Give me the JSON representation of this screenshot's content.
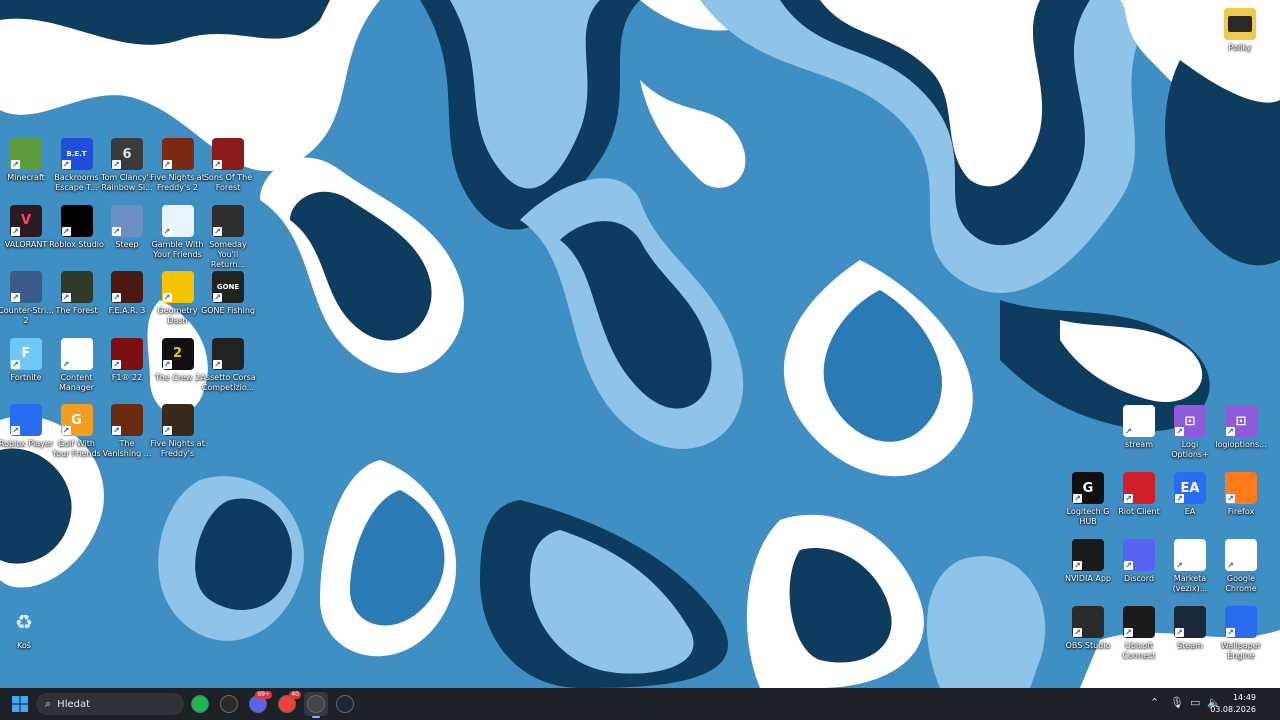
{
  "desktop": {
    "left_icons": [
      {
        "name": "minecraft",
        "label": "Minecraft",
        "glyph": "",
        "bg": "#5c9c3c",
        "fg": "#ffffff"
      },
      {
        "name": "backrooms",
        "label": "Backrooms Escape T...",
        "glyph": "B.E.T",
        "bg": "#1f4fd8",
        "fg": "#ffffff"
      },
      {
        "name": "rainbow-six",
        "label": "Tom Clancy's Rainbow Si...",
        "glyph": "6",
        "bg": "#3b3b3b",
        "fg": "#e0e0e0"
      },
      {
        "name": "fnaf2",
        "label": "Five Nights at Freddy's 2",
        "glyph": "",
        "bg": "#7a2a10",
        "fg": "#ffffff"
      },
      {
        "name": "sons-of-forest",
        "label": "Sons Of The Forest",
        "glyph": "",
        "bg": "#8e1b1b",
        "fg": "#ffffff"
      },
      {
        "name": "valorant",
        "label": "VALORANT",
        "glyph": "V",
        "bg": "#2a1a22",
        "fg": "#ff4655"
      },
      {
        "name": "roblox-studio",
        "label": "Roblox Studio",
        "glyph": "",
        "bg": "#000000",
        "fg": "#ffffff"
      },
      {
        "name": "steep",
        "label": "Steep",
        "glyph": "",
        "bg": "#6a8fc0",
        "fg": "#ffffff"
      },
      {
        "name": "gamble",
        "label": "Gamble With Your Friends",
        "glyph": "",
        "bg": "#e8f4ff",
        "fg": "#1c5fb0"
      },
      {
        "name": "someday",
        "label": "Someday You'll Return...",
        "glyph": "",
        "bg": "#2e2e2e",
        "fg": "#c9a86a"
      },
      {
        "name": "counter-strike",
        "label": "Counter-Stri... 2",
        "glyph": "",
        "bg": "#3c5a8a",
        "fg": "#f5a623"
      },
      {
        "name": "the-forest",
        "label": "The Forest",
        "glyph": "",
        "bg": "#2f3a2a",
        "fg": "#c8c8c8"
      },
      {
        "name": "fear3",
        "label": "F.E.A.R. 3",
        "glyph": "",
        "bg": "#4a1a12",
        "fg": "#e9b44c"
      },
      {
        "name": "geometry-dash",
        "label": "Geometry Dash",
        "glyph": "",
        "bg": "#f5c400",
        "fg": "#2a7a1a"
      },
      {
        "name": "gone-fishing",
        "label": "GONE Fishing",
        "glyph": "GONE",
        "bg": "#222222",
        "fg": "#ffffff"
      },
      {
        "name": "fortnite",
        "label": "Fortnite",
        "glyph": "F",
        "bg": "#6ec8f5",
        "fg": "#ffffff"
      },
      {
        "name": "content-manager",
        "label": "Content Manager",
        "glyph": "",
        "bg": "#ffffff",
        "fg": "#e02020"
      },
      {
        "name": "f1-22",
        "label": "F1® 22",
        "glyph": "",
        "bg": "#7a1010",
        "fg": "#ffffff"
      },
      {
        "name": "the-crew-2",
        "label": "The Crew 2",
        "glyph": "2",
        "bg": "#111111",
        "fg": "#f5c400"
      },
      {
        "name": "assetto-corsa",
        "label": "Assetto Corsa Competizio...",
        "glyph": "",
        "bg": "#222222",
        "fg": "#e02020"
      },
      {
        "name": "roblox-player",
        "label": "Roblox Player",
        "glyph": "",
        "bg": "#2a6cf0",
        "fg": "#ffffff"
      },
      {
        "name": "golf",
        "label": "Golf With Your Friends",
        "glyph": "G",
        "bg": "#f29d1f",
        "fg": "#ffffff"
      },
      {
        "name": "vanishing",
        "label": "The Vanishing ...",
        "glyph": "",
        "bg": "#6a2a10",
        "fg": "#f0c080"
      },
      {
        "name": "fnaf",
        "label": "Five Nights at Freddy's",
        "glyph": "",
        "bg": "#3a2a1a",
        "fg": "#ffffff"
      }
    ],
    "right_icons": [
      {
        "name": "stream",
        "label": "stream",
        "glyph": "",
        "bg": "#ffffff",
        "fg": "#444444"
      },
      {
        "name": "logi-options",
        "label": "Logi Options+",
        "glyph": "⊡",
        "bg": "#8f5bd8",
        "fg": "#ffffff"
      },
      {
        "name": "logioptions",
        "label": "logioptions...",
        "glyph": "⊡",
        "bg": "#8f5bd8",
        "fg": "#ffffff"
      },
      {
        "name": "logitech-g-hub",
        "label": "Logitech G HUB",
        "glyph": "G",
        "bg": "#111111",
        "fg": "#ffffff"
      },
      {
        "name": "riot-client",
        "label": "Riot Client",
        "glyph": "",
        "bg": "#d0202a",
        "fg": "#ffffff"
      },
      {
        "name": "ea",
        "label": "EA",
        "glyph": "EA",
        "bg": "#2a6cf0",
        "fg": "#ffffff"
      },
      {
        "name": "firefox",
        "label": "Firefox",
        "glyph": "",
        "bg": "#ff7a1a",
        "fg": "#ffffff"
      },
      {
        "name": "nvidia-app",
        "label": "NVIDIA App",
        "glyph": "",
        "bg": "#1a1a1a",
        "fg": "#76b900"
      },
      {
        "name": "discord",
        "label": "Discord",
        "glyph": "",
        "bg": "#5865f2",
        "fg": "#ffffff"
      },
      {
        "name": "marketa",
        "label": "Marketa (vezix)...",
        "glyph": "",
        "bg": "#ffffff",
        "fg": "#ea4335"
      },
      {
        "name": "google-chrome",
        "label": "Google Chrome",
        "glyph": "",
        "bg": "#ffffff",
        "fg": "#ea4335"
      },
      {
        "name": "obs",
        "label": "OBS Studio",
        "glyph": "",
        "bg": "#2a2a2a",
        "fg": "#ffffff"
      },
      {
        "name": "ubisoft",
        "label": "Ubisoft Connect",
        "glyph": "",
        "bg": "#1a1a1a",
        "fg": "#ffffff"
      },
      {
        "name": "steam",
        "label": "Steam",
        "glyph": "",
        "bg": "#1b2838",
        "fg": "#ffffff"
      },
      {
        "name": "wallpaper-engine",
        "label": "Wallpaper Engine",
        "glyph": "",
        "bg": "#2a6cf0",
        "fg": "#ffffff"
      }
    ],
    "folder": {
      "label": "Pollky"
    },
    "recycle_bin": {
      "label": "Koš"
    }
  },
  "taskbar": {
    "search_placeholder": "Hledat",
    "apps": [
      {
        "name": "spotify",
        "color": "#1db954"
      },
      {
        "name": "epic-games",
        "color": "#2a2a2a"
      },
      {
        "name": "discord",
        "color": "#5865f2",
        "badge": "99+"
      },
      {
        "name": "chrome",
        "color": "#ea4335",
        "badge": "40"
      },
      {
        "name": "obs",
        "color": "#444444"
      },
      {
        "name": "steam",
        "color": "#1b2838"
      }
    ],
    "time": "14:49",
    "date": "03.08.2026"
  },
  "colors": {
    "wall_dark": "#0b3a5c",
    "wall_mid": "#2a7ab6",
    "wall_light": "#8fc3e8",
    "wall_white": "#ffffff",
    "taskbar": "#1c2027"
  }
}
